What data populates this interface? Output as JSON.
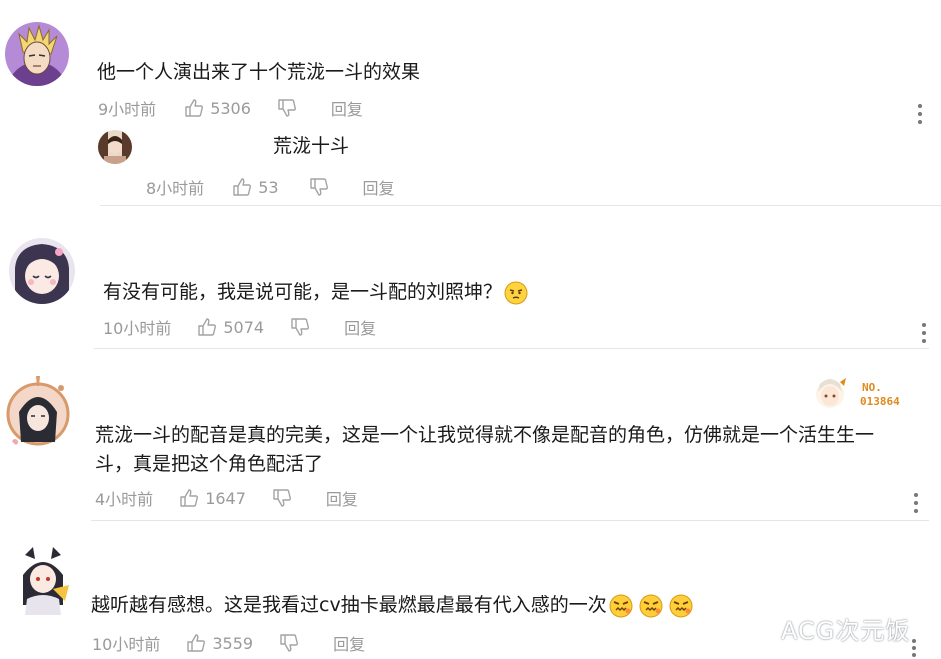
{
  "comments": [
    {
      "text": "他一个人演出来了十个荒泷一斗的效果",
      "time": "9小时前",
      "likes": "5306",
      "reply_label": "回复",
      "reply": {
        "text": "荒泷十斗",
        "time": "8小时前",
        "likes": "53",
        "reply_label": "回复"
      }
    },
    {
      "text": "有没有可能，我是说可能，是一斗配的刘照坤？",
      "time": "10小时前",
      "likes": "5074",
      "reply_label": "回复"
    },
    {
      "text_line1": "荒泷一斗的配音是真的完美，这是一个让我觉得就不像是配音的角色，仿佛就是一个活生生一",
      "text_line2": "斗，真是把这个角色配活了",
      "time": "4小时前",
      "likes": "1647",
      "reply_label": "回复",
      "badge_text_1": "NO.",
      "badge_text_2": "013864"
    },
    {
      "text": "越听越有感想。这是我看过cv抽卡最燃最虐最有代入感的一次",
      "time": "10小时前",
      "likes": "3559",
      "reply_label": "回复"
    }
  ],
  "watermark": "ACG次元饭",
  "icons": {
    "like": "thumbs-up-icon",
    "dislike": "thumbs-down-icon",
    "more": "more-vertical-icon"
  },
  "colors": {
    "meta": "#9a9a9a",
    "text": "#1a1a1a",
    "divider": "#e6e6e6",
    "badge": "#e08a1e"
  }
}
